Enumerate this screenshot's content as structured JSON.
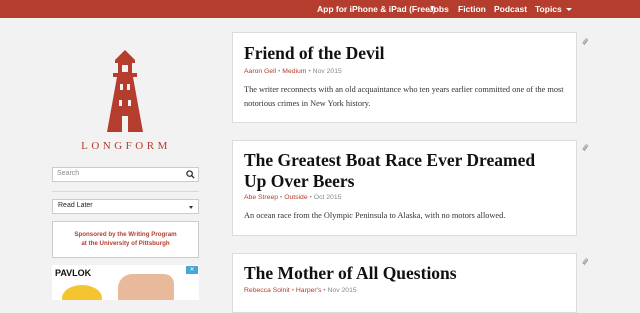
{
  "nav": {
    "app": "App for iPhone & iPad (Free!)",
    "jobs": "Jobs",
    "fiction": "Fiction",
    "podcast": "Podcast",
    "topics": "Topics"
  },
  "brand": {
    "name": "LONGFORM",
    "color": "#b43d2d"
  },
  "sidebar": {
    "search_placeholder": "Search",
    "list_select": "Read Later",
    "sponsor_line1": "Sponsored by the Writing Program",
    "sponsor_line2": "at the University of Pittsburgh",
    "ad_brand": "PAVLOK"
  },
  "articles": [
    {
      "title": "Friend of the Devil",
      "author": "Aaron Gell",
      "publication": "Medium",
      "date": "Nov 2015",
      "description": "The writer reconnects with an old acquaintance who ten years earlier committed one of the most notorious crimes in New York history."
    },
    {
      "title_line1": "The Greatest Boat Race Ever Dreamed",
      "title_line2": "Up Over Beers",
      "author": "Abe Streep",
      "publication": "Outside",
      "date": "Oct 2015",
      "description": "An ocean race from the Olympic Peninsula to Alaska, with no motors allowed."
    },
    {
      "title": "The Mother of All Questions",
      "author": "Rebecca Solnit",
      "publication": "Harper's",
      "date": "Nov 2015"
    }
  ]
}
